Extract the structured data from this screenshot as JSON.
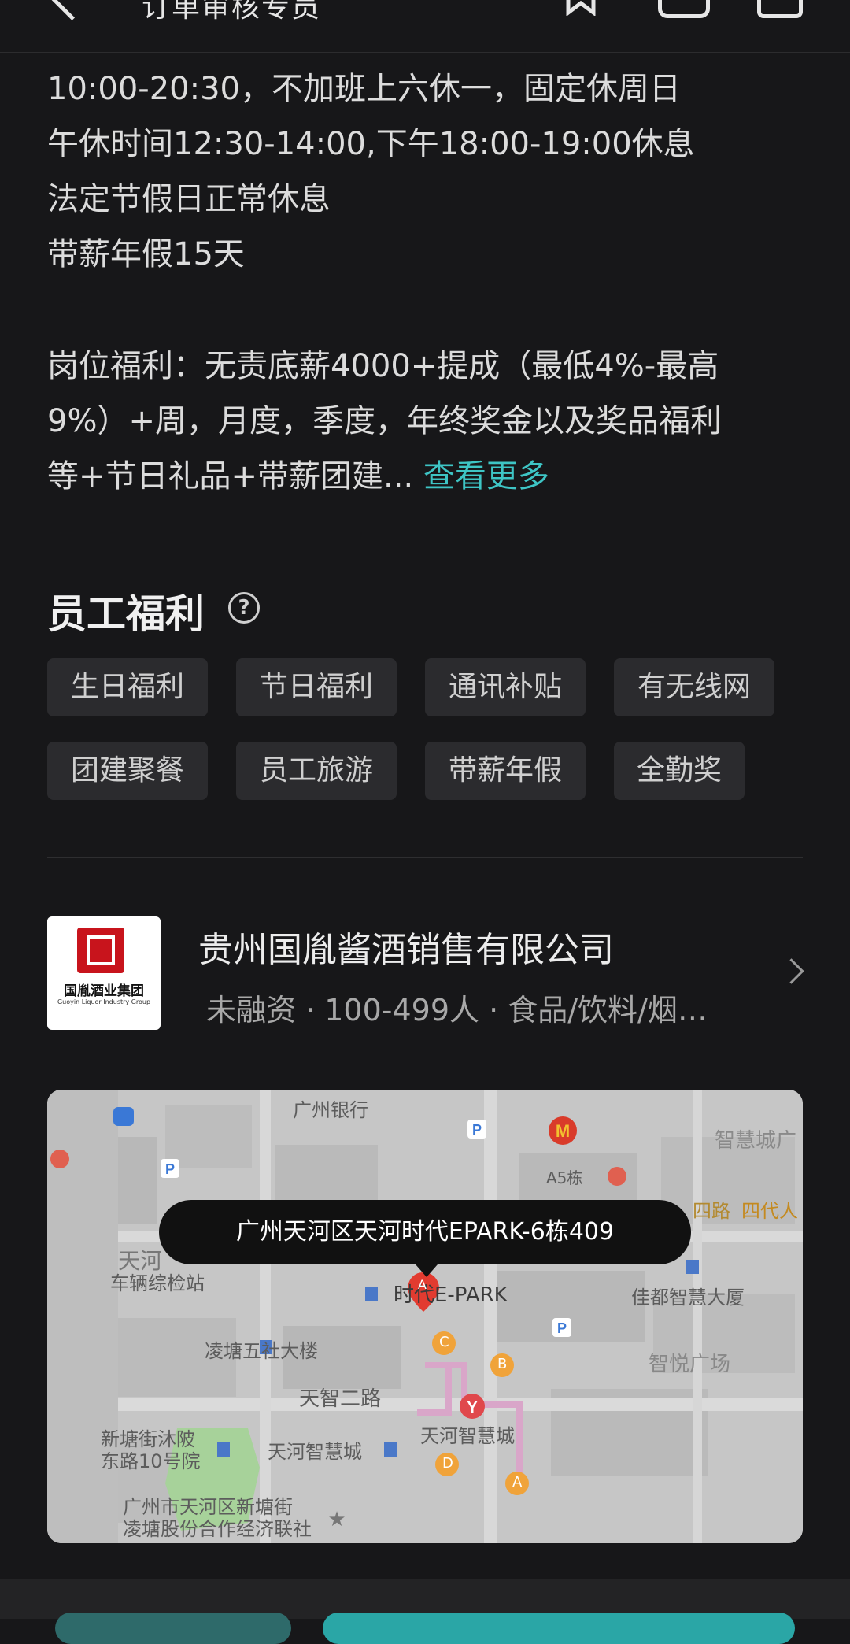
{
  "header": {
    "title": "订单审核专员"
  },
  "description": {
    "lines": [
      "10:00-20:30，不加班上六休一，固定休周日",
      "午休时间12:30-14:00,下午18:00-19:00休息",
      "法定节假日正常休息",
      "带薪年假15天"
    ],
    "benefit_lines": [
      "岗位福利：无责底薪4000+提成（最低4%-最高",
      "9%）+周，月度，季度，年终奖金以及奖品福利",
      "等+节日礼品+带薪团建..."
    ],
    "more_link": "查看更多"
  },
  "benefits": {
    "title": "员工福利",
    "help_glyph": "?",
    "tags": [
      "生日福利",
      "节日福利",
      "通讯补贴",
      "有无线网",
      "团建聚餐",
      "员工旅游",
      "带薪年假",
      "全勤奖"
    ]
  },
  "company": {
    "logo_text": "国胤酒业集团",
    "logo_subtext": "Guoyin Liquor Industry Group",
    "name": "贵州国胤酱酒销售有限公司",
    "meta": "未融资 · 100-499人 · 食品/饮料/烟…"
  },
  "map": {
    "address": "广州天河区天河时代EPARK-6栋409",
    "labels": {
      "bank": "广州银行",
      "mall": "智慧城广",
      "a5": "A5栋",
      "road": "四路",
      "foursome": "四代人",
      "station1": "天河",
      "station2": "车辆综检站",
      "epark": "时代E-PARK",
      "jiadu": "佳都智慧大厦",
      "lingtang": "凌塘五社大楼",
      "zhiyue": "智悦广场",
      "tianzhi": "天智二路",
      "xintang1": "新塘街沐陂",
      "xintang2": "东路10号院",
      "tianhe_zhihui1": "天河智慧城",
      "tianhe_zhihui2": "天河智慧城",
      "coop1": "广州市天河区新塘街",
      "coop2": "凌塘股份合作经济联社",
      "pin": "A",
      "exit_a": "A",
      "exit_b": "B",
      "exit_c": "C",
      "exit_d": "D"
    }
  }
}
